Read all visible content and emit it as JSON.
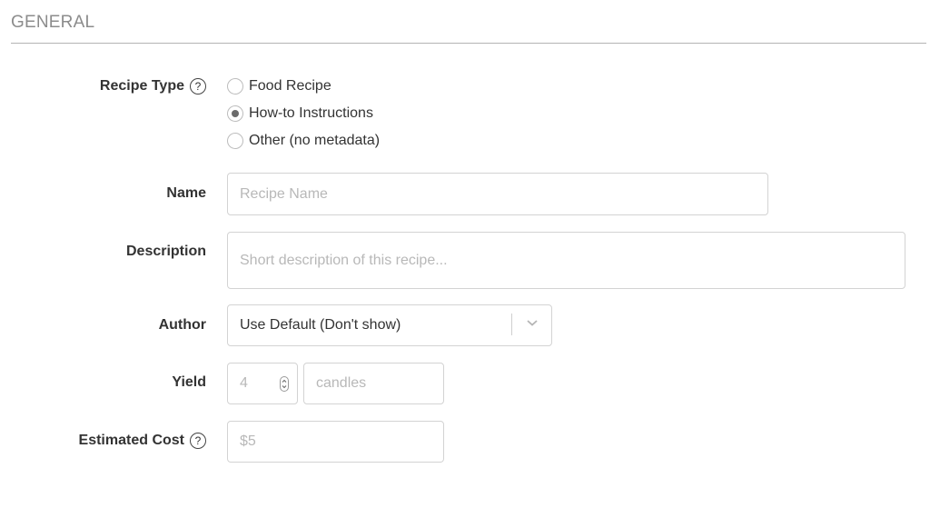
{
  "section": {
    "title": "GENERAL"
  },
  "fields": {
    "recipe_type": {
      "label": "Recipe Type",
      "help_icon": "?",
      "options": [
        {
          "label": "Food Recipe",
          "checked": false
        },
        {
          "label": "How-to Instructions",
          "checked": true
        },
        {
          "label": "Other (no metadata)",
          "checked": false
        }
      ]
    },
    "name": {
      "label": "Name",
      "value": "",
      "placeholder": "Recipe Name"
    },
    "description": {
      "label": "Description",
      "value": "",
      "placeholder": "Short description of this recipe..."
    },
    "author": {
      "label": "Author",
      "selected": "Use Default (Don't show)"
    },
    "yield": {
      "label": "Yield",
      "quantity_placeholder": "4",
      "unit_placeholder": "candles"
    },
    "estimated_cost": {
      "label": "Estimated Cost",
      "help_icon": "?",
      "placeholder": "$5"
    }
  }
}
